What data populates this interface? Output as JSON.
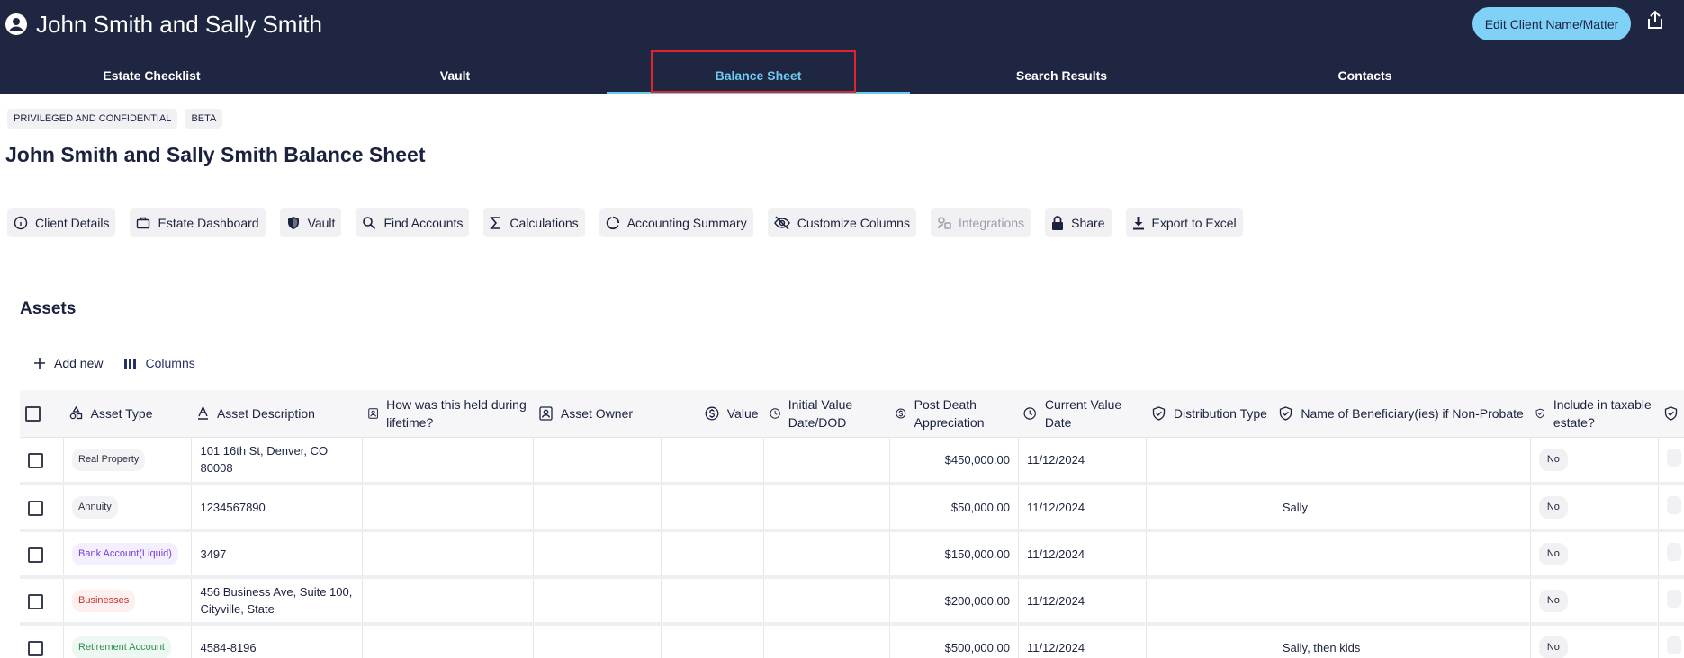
{
  "header": {
    "client_name": "John Smith and Sally Smith",
    "edit_button": "Edit Client Name/Matter"
  },
  "tabs": [
    {
      "label": "Estate Checklist",
      "active": false
    },
    {
      "label": "Vault",
      "active": false
    },
    {
      "label": "Balance Sheet",
      "active": true
    },
    {
      "label": "Search Results",
      "active": false
    },
    {
      "label": "Contacts",
      "active": false
    }
  ],
  "badges": [
    "PRIVILEGED AND CONFIDENTIAL",
    "BETA"
  ],
  "page_title": "John Smith and Sally Smith Balance Sheet",
  "toolbar": [
    {
      "label": "Client Details",
      "icon": "info-icon"
    },
    {
      "label": "Estate Dashboard",
      "icon": "briefcase-icon"
    },
    {
      "label": "Vault",
      "icon": "shield-icon"
    },
    {
      "label": "Find Accounts",
      "icon": "search-icon"
    },
    {
      "label": "Calculations",
      "icon": "sigma-icon"
    },
    {
      "label": "Accounting Summary",
      "icon": "donut-icon"
    },
    {
      "label": "Customize Columns",
      "icon": "eye-off-icon"
    },
    {
      "label": "Integrations",
      "icon": "integrations-icon",
      "disabled": true
    },
    {
      "label": "Share",
      "icon": "lock-icon"
    },
    {
      "label": "Export to Excel",
      "icon": "download-icon"
    }
  ],
  "assets": {
    "title": "Assets",
    "add_new": "Add new",
    "columns_label": "Columns",
    "headers": {
      "asset_type": "Asset Type",
      "asset_description": "Asset Description",
      "held": "How was this held during lifetime?",
      "owner": "Asset Owner",
      "value": "Value",
      "initial_value_date": "Initial Value Date/DOD",
      "post_death": "Post Death Appreciation",
      "current_value_date": "Current Value Date",
      "distribution": "Distribution Type",
      "beneficiary": "Name of Beneficiary(ies) if Non-Probate",
      "taxable": "Include in taxable estate?"
    },
    "rows": [
      {
        "type": "Real Property",
        "description": "101 16th St, Denver, CO 80008",
        "held": "",
        "owner": "",
        "value": "",
        "initial_value_date": "",
        "post_death": "$450,000.00",
        "current_value_date": "11/12/2024",
        "distribution": "",
        "beneficiary": "",
        "taxable": "No"
      },
      {
        "type": "Annuity",
        "description": "1234567890",
        "held": "",
        "owner": "",
        "value": "",
        "initial_value_date": "",
        "post_death": "$50,000.00",
        "current_value_date": "11/12/2024",
        "distribution": "",
        "beneficiary": "Sally",
        "taxable": "No"
      },
      {
        "type": "Bank Account(Liquid)",
        "description": "3497",
        "held": "",
        "owner": "",
        "value": "",
        "initial_value_date": "",
        "post_death": "$150,000.00",
        "current_value_date": "11/12/2024",
        "distribution": "",
        "beneficiary": "",
        "taxable": "No"
      },
      {
        "type": "Businesses",
        "description": "456 Business Ave, Suite 100, Cityville, State",
        "held": "",
        "owner": "",
        "value": "",
        "initial_value_date": "",
        "post_death": "$200,000.00",
        "current_value_date": "11/12/2024",
        "distribution": "",
        "beneficiary": "",
        "taxable": "No"
      },
      {
        "type": "Retirement Account",
        "description": "4584-8196",
        "held": "",
        "owner": "",
        "value": "",
        "initial_value_date": "",
        "post_death": "$500,000.00",
        "current_value_date": "11/12/2024",
        "distribution": "",
        "beneficiary": "Sally, then kids",
        "taxable": "No"
      }
    ]
  },
  "colors": {
    "header_bg": "#1f2642",
    "accent": "#6fc9f0",
    "highlight": "#e0242a"
  }
}
